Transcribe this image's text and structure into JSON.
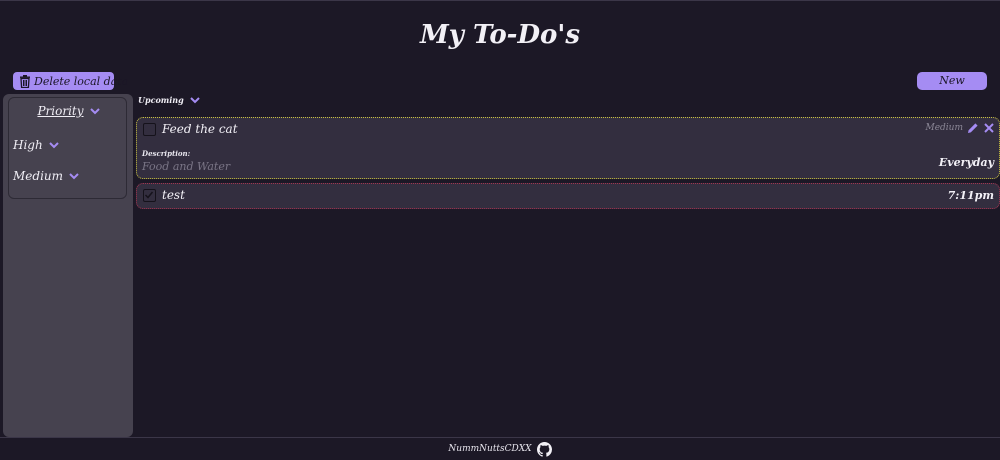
{
  "app": {
    "title": "My To-Do's"
  },
  "toolbar": {
    "delete_label": "Delete local data",
    "new_label": "New"
  },
  "sidebar": {
    "title": "Priority",
    "items": [
      {
        "label": "High"
      },
      {
        "label": "Medium"
      }
    ]
  },
  "section": {
    "label": "Upcoming"
  },
  "tasks": [
    {
      "name": "Feed the cat",
      "priority": "Medium",
      "checked": false,
      "description_label": "Description:",
      "description": "Food and Water",
      "time": "Everyday",
      "border_color": "#c9c13d"
    },
    {
      "name": "test",
      "checked": true,
      "time": "7:11pm",
      "border_color": "#a3334f"
    }
  ],
  "footer": {
    "author": "NummNuttsCDXX",
    "icon": "github-icon"
  },
  "colors": {
    "accent": "#a58cf3",
    "background": "#1c1826",
    "sidebar": "#46424f",
    "card": "#332e3f"
  }
}
